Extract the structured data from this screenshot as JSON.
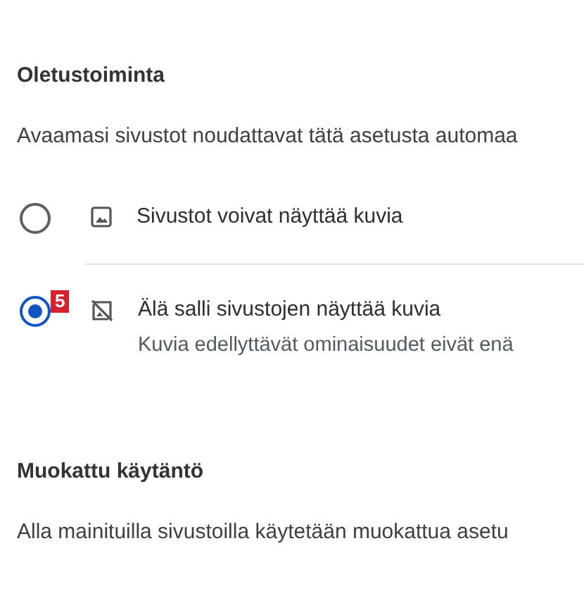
{
  "sections": [
    {
      "heading": "Oletustoiminta",
      "description": "Avaamasi sivustot noudattavat tätä asetusta automaa",
      "options": [
        {
          "kind": "allow",
          "label": "Sivustot voivat näyttää kuvia",
          "selected": false
        },
        {
          "kind": "block",
          "label": "Älä salli sivustojen näyttää kuvia",
          "sublabel": "Kuvia edellyttävät ominaisuudet eivät enä",
          "selected": true,
          "badge": "5"
        }
      ]
    },
    {
      "heading": "Muokattu käytäntö",
      "description": "Alla mainituilla sivustoilla käytetään muokattua asetu"
    }
  ]
}
